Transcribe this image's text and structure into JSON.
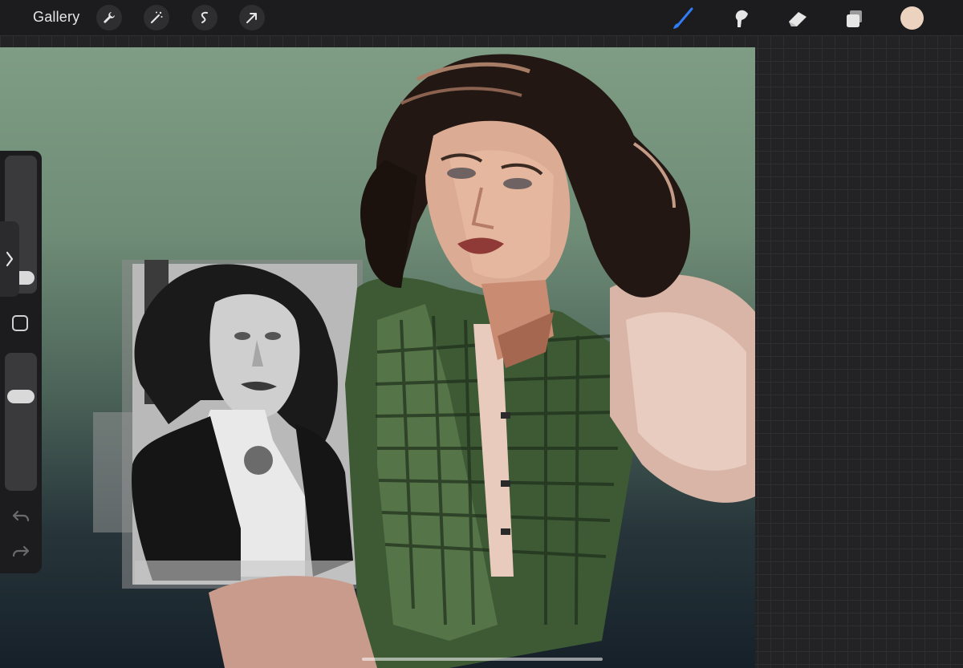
{
  "toolbar": {
    "gallery_label": "Gallery",
    "left_tools": [
      "wrench-icon",
      "magic-wand-icon",
      "selection-icon",
      "transform-arrow-icon"
    ],
    "right_tools": [
      "brush-icon",
      "smudge-icon",
      "eraser-icon",
      "layers-icon"
    ],
    "active_tool": "brush-icon",
    "active_tool_color": "#2f7cf6",
    "current_color": "#ecd3bf"
  },
  "sidebar": {
    "brush_size_level": 0.1,
    "brush_opacity_level": 0.75,
    "modify_button": "square-icon",
    "undo": "undo-icon",
    "redo": "redo-icon"
  },
  "canvas": {
    "background_top": "#7f9c84",
    "background_bottom": "#162029"
  }
}
